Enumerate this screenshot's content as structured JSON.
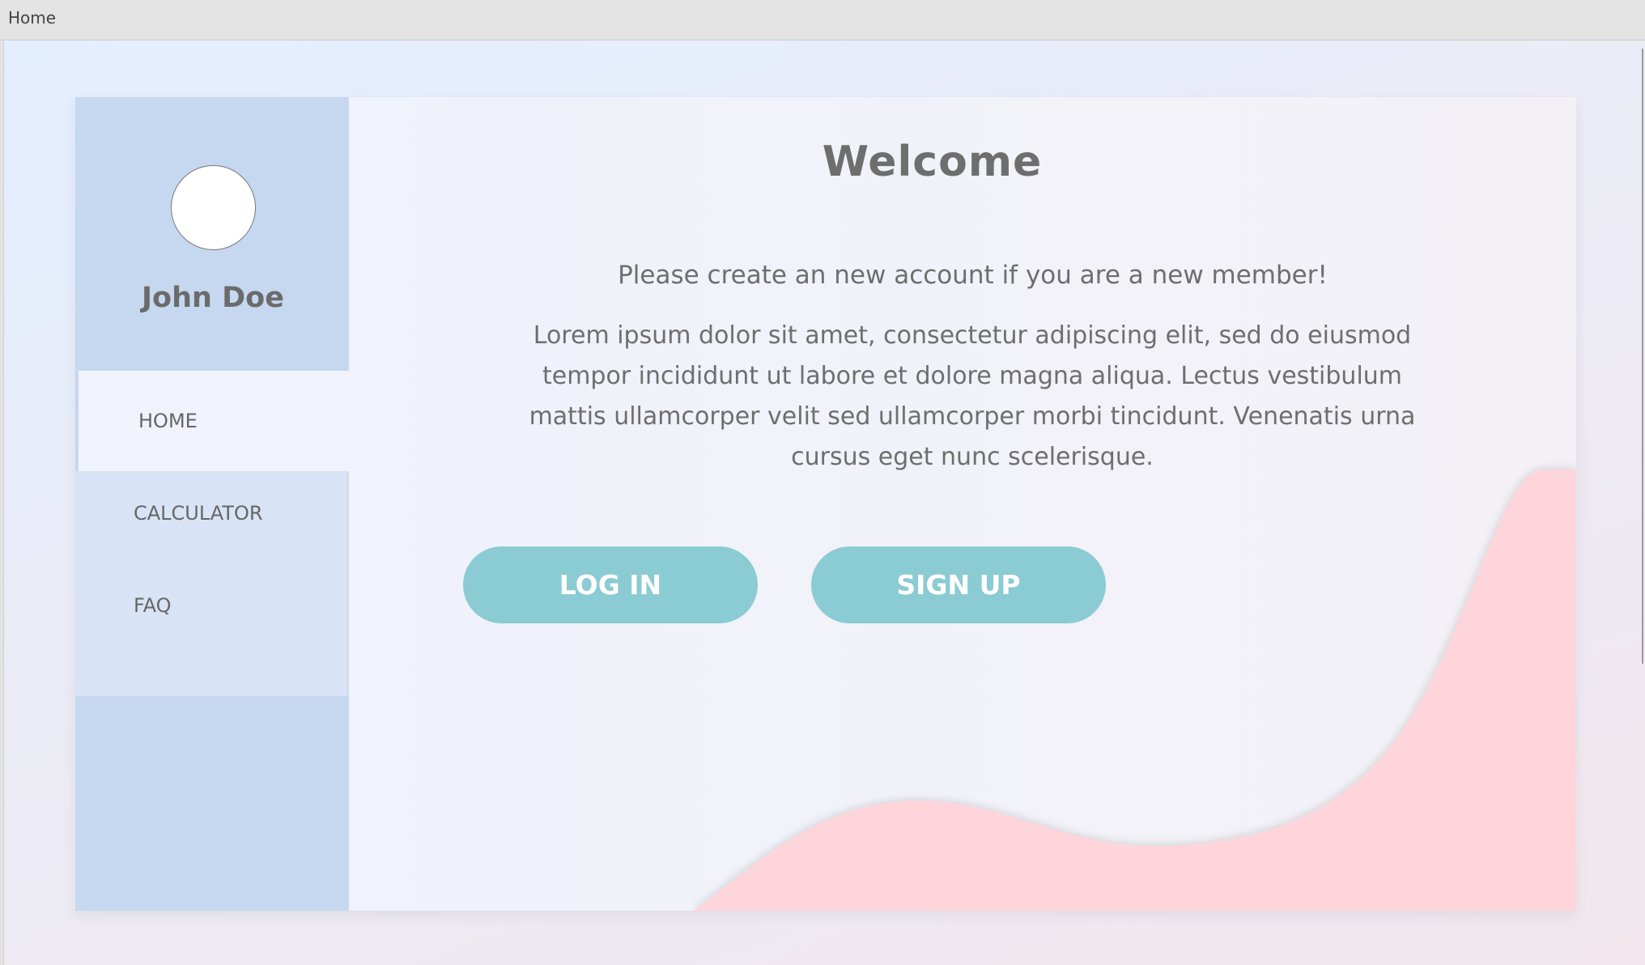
{
  "window": {
    "title": "Home"
  },
  "profile": {
    "name": "John Doe"
  },
  "nav": {
    "items": [
      {
        "label": "HOME",
        "active": true
      },
      {
        "label": "CALCULATOR",
        "active": false
      },
      {
        "label": "FAQ",
        "active": false
      }
    ]
  },
  "main": {
    "heading": "Welcome",
    "subtitle": "Please create an new account if you are a new member!",
    "body": "Lorem ipsum dolor sit amet, consectetur adipiscing elit, sed do eiusmod tempor incididunt ut labore et dolore magna aliqua. Lectus vestibulum mattis ullamcorper velit sed ullamcorper morbi tincidunt. Venenatis urna cursus eget nunc scelerisque.",
    "login_label": "LOG IN",
    "signup_label": "SIGN UP"
  },
  "colors": {
    "sidebar": "#c5d8f0",
    "nav_background": "#d8e4f5",
    "active_item": "#f0f3fc",
    "button": "#8bcbd3",
    "wave": "#ffd5dc",
    "text": "#6e6e6e"
  }
}
